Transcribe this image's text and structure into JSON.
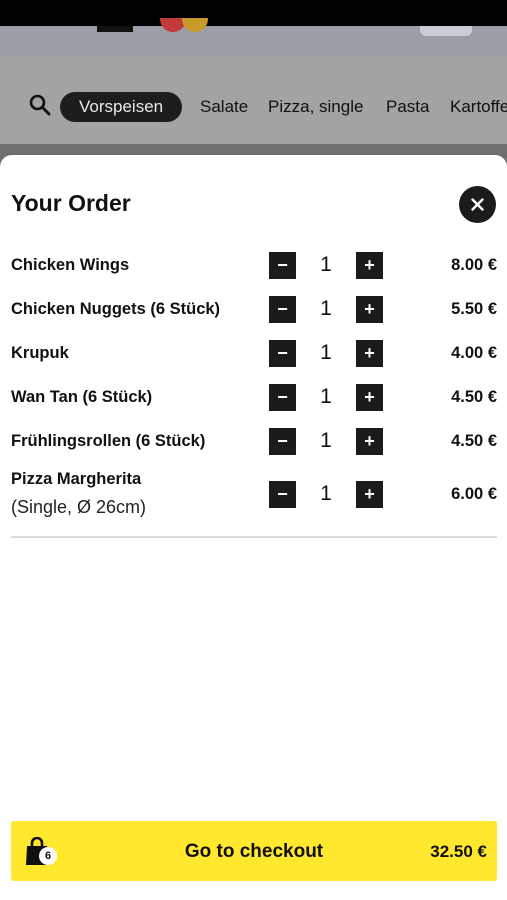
{
  "categories": [
    "Vorspeisen",
    "Salate",
    "Pizza, single",
    "Pasta",
    "Kartoffe"
  ],
  "active_category": "Vorspeisen",
  "order": {
    "title": "Your Order",
    "items": [
      {
        "name": "Chicken Wings",
        "qty": "1",
        "price": "8.00 €"
      },
      {
        "name": "Chicken Nuggets (6 Stück)",
        "qty": "1",
        "price": "5.50 €"
      },
      {
        "name": "Krupuk",
        "qty": "1",
        "price": "4.00 €"
      },
      {
        "name": "Wan Tan (6 Stück)",
        "qty": "1",
        "price": "4.50 €"
      },
      {
        "name": "Frühlingsrollen (6 Stück)",
        "qty": "1",
        "price": "4.50 €"
      },
      {
        "name": "Pizza Margherita",
        "note": "(Single, Ø 26cm)",
        "qty": "1",
        "price": "6.00 €"
      }
    ],
    "minus_symbol": "−",
    "plus_symbol": "+"
  },
  "checkout": {
    "label": "Go to checkout",
    "badge_count": "6",
    "total": "32.50 €"
  },
  "icons": {
    "search": "search-icon",
    "close": "close-icon",
    "bag": "shopping-bag-icon"
  },
  "colors": {
    "accent": "#ffe82e",
    "dark": "#1b1b1b"
  }
}
